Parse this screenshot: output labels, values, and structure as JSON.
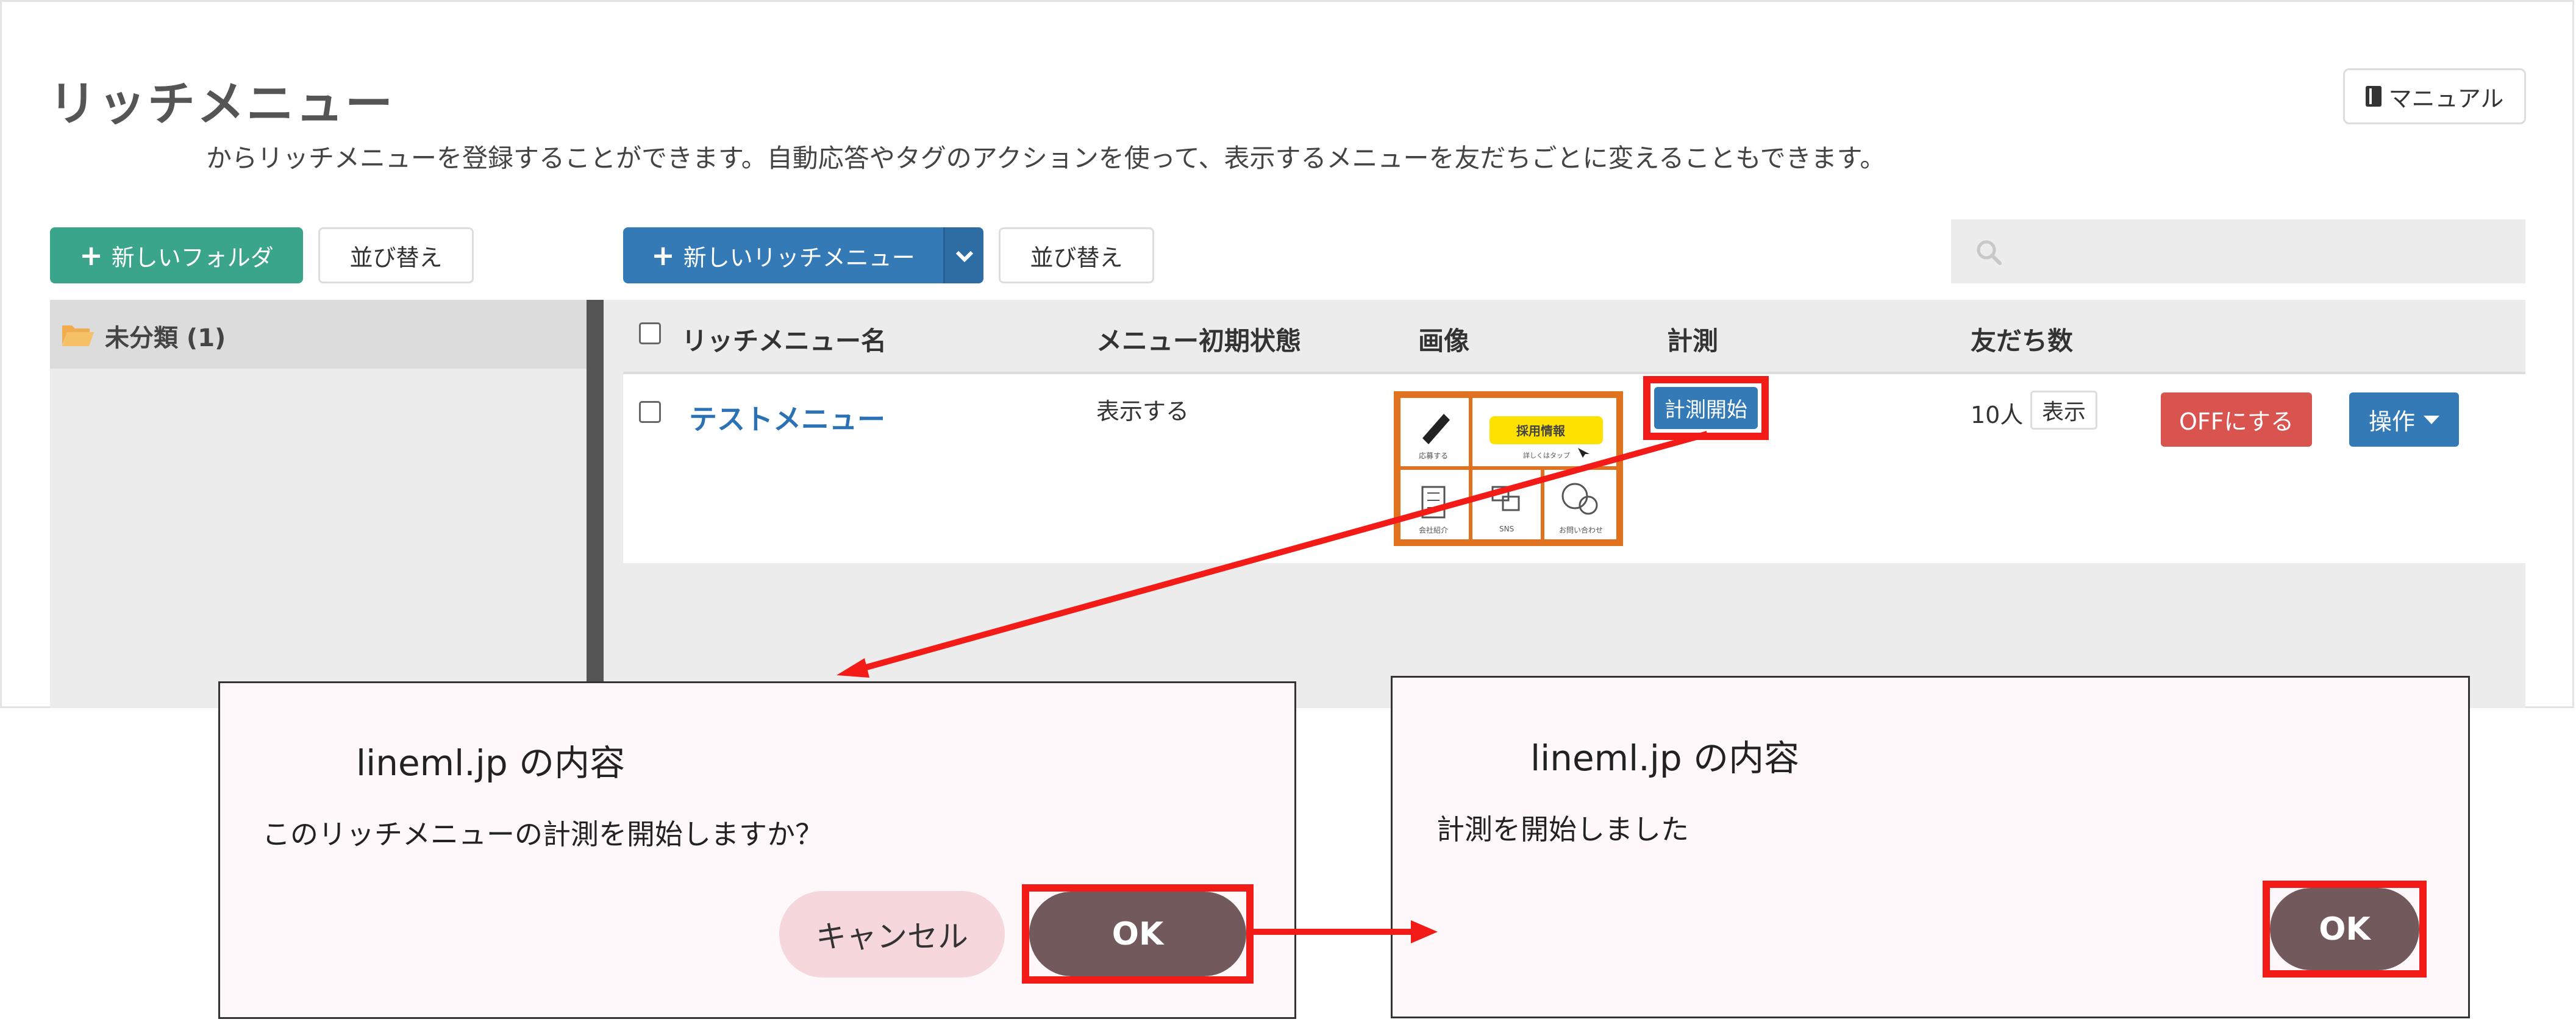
{
  "page": {
    "title": "リッチメニュー",
    "description": "からリッチメニューを登録することができます。自動応答やタグのアクションを使って、表示するメニューを友だちごとに変えることもできます。",
    "manual_label": "マニュアル"
  },
  "toolbar": {
    "new_folder_label": "新しいフォルダ",
    "sort_folder_label": "並び替え",
    "new_rich_menu_label": "新しいリッチメニュー",
    "sort_menu_label": "並び替え",
    "search_placeholder": ""
  },
  "folders": [
    {
      "label": "未分類 (1)"
    }
  ],
  "table": {
    "headers": [
      "リッチメニュー名",
      "メニュー初期状態",
      "画像",
      "計測",
      "友だち数"
    ],
    "rows": [
      {
        "name": "テストメニュー",
        "initial_state": "表示する",
        "measure_button": "計測開始",
        "friends": "10人",
        "show_button": "表示",
        "off_button": "OFFにする",
        "ops_button": "操作"
      }
    ]
  },
  "thumbnail": {
    "cells": [
      "応募する",
      "採用情報",
      "会社紹介",
      "SNS",
      "お問い合わせ"
    ],
    "subtext": "詳しくはタップ"
  },
  "dialog_confirm": {
    "title": "lineml.jp の内容",
    "message": "このリッチメニューの計測を開始しますか？",
    "cancel_label": "キャンセル",
    "ok_label": "OK"
  },
  "dialog_done": {
    "title": "lineml.jp の内容",
    "message": "計測を開始しました",
    "ok_label": "OK"
  },
  "colors": {
    "primary": "#337ab7",
    "green": "#3aa58b",
    "danger": "#d9534f",
    "highlight": "#f21b17",
    "dialog_ok": "#725a5c",
    "dialog_cancel": "#f6d7db"
  }
}
